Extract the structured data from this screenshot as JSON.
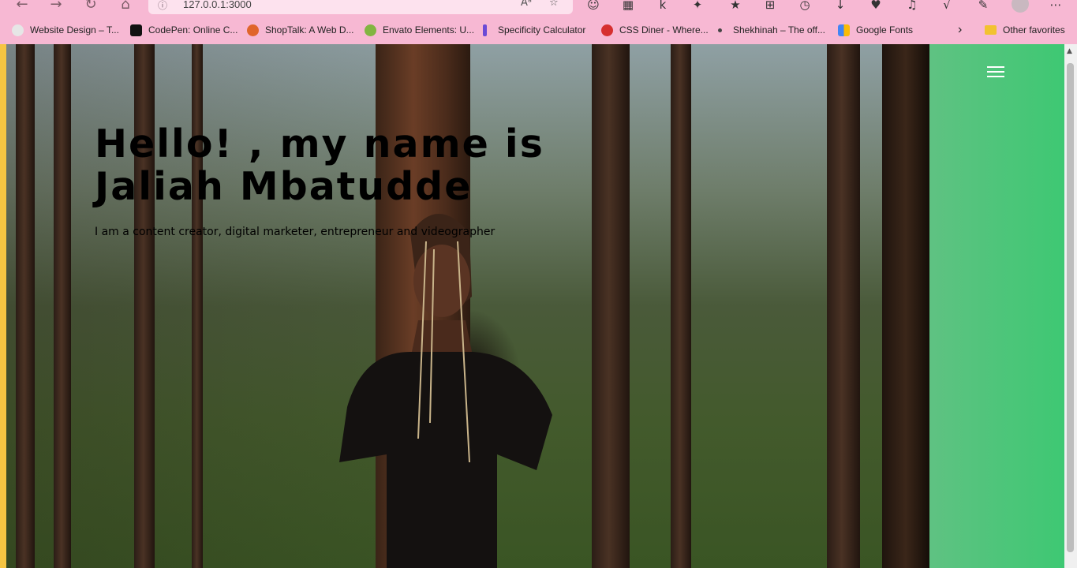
{
  "browser": {
    "url": "127.0.0.1:3000",
    "reader_label": "Aᵃ",
    "bookmarks": [
      {
        "label": "Website Design – T...",
        "icon": "website-design-icon",
        "color": "#e6e6e6"
      },
      {
        "label": "CodePen: Online C...",
        "icon": "codepen-icon",
        "color": "#111111"
      },
      {
        "label": "ShopTalk: A Web D...",
        "icon": "shoptalk-icon",
        "color": "#e0652b"
      },
      {
        "label": "Envato Elements: U...",
        "icon": "envato-icon",
        "color": "#82b541"
      },
      {
        "label": "Specificity Calculator",
        "icon": "specificity-icon",
        "color": "#6b4bd6"
      },
      {
        "label": "CSS Diner - Where...",
        "icon": "css-diner-icon",
        "color": "#d62f2f"
      },
      {
        "label": "Shekhinah – The off...",
        "icon": "shekhinah-icon",
        "color": "#444444"
      },
      {
        "label": "Google Fonts",
        "icon": "google-fonts-icon",
        "color": "#4285f4"
      }
    ],
    "other_favorites": "Other favorites"
  },
  "hero": {
    "title": "Hello! , my name is Jaliah Mbatudde",
    "subtitle": "I am a content creator, digital marketer, entrepreneur and videographer"
  },
  "colors": {
    "browser_chrome": "#f7b8d3",
    "sidebar": "#3ec873",
    "left_strip": "#f5c542"
  }
}
